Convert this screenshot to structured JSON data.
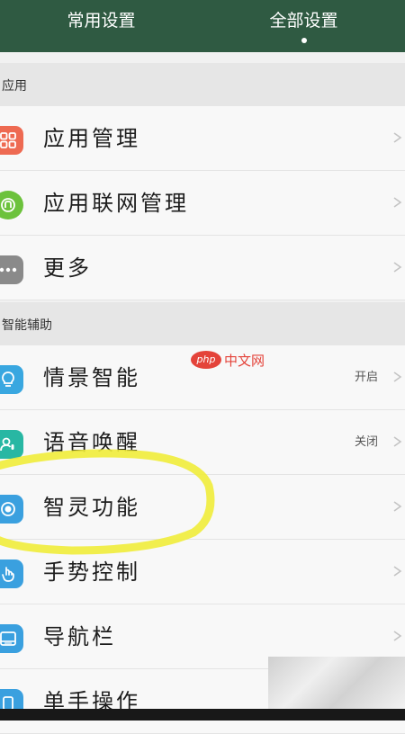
{
  "tabs": [
    {
      "label": "常用设置",
      "active": false
    },
    {
      "label": "全部设置",
      "active": true
    }
  ],
  "sections": [
    {
      "title": "应用"
    },
    {
      "title": "智能辅助"
    }
  ],
  "rows": [
    {
      "label": "应用管理",
      "status": "",
      "icon": "app-grid-icon",
      "color": "#ee6a52"
    },
    {
      "label": "应用联网管理",
      "status": "",
      "icon": "network-icon",
      "color": "#6cc23c"
    },
    {
      "label": "更多",
      "status": "",
      "icon": "more-dots-icon",
      "color": "#8a8a8a"
    },
    {
      "label": "情景智能",
      "status": "开启",
      "icon": "lightbulb-icon",
      "color": "#39a7e0"
    },
    {
      "label": "语音唤醒",
      "status": "关闭",
      "icon": "voice-icon",
      "color": "#28b7a3"
    },
    {
      "label": "智灵功能",
      "status": "",
      "icon": "target-icon",
      "color": "#3aa0df"
    },
    {
      "label": "手势控制",
      "status": "",
      "icon": "gesture-icon",
      "color": "#3aa0df"
    },
    {
      "label": "导航栏",
      "status": "",
      "icon": "navbar-icon",
      "color": "#3aa0df"
    },
    {
      "label": "单手操作",
      "status": "",
      "icon": "one-hand-icon",
      "color": "#3aa0df"
    }
  ],
  "watermark": {
    "logo": "php",
    "text": "中文网"
  },
  "colors": {
    "header_bg": "#2f5a42",
    "highlight": "#f0ec3a"
  }
}
